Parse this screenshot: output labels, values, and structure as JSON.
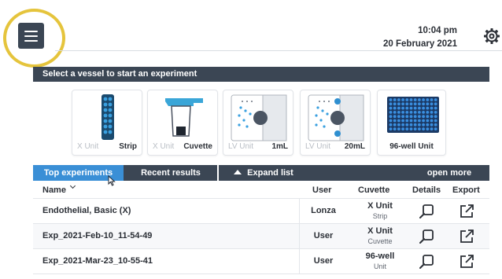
{
  "header": {
    "time": "10:04 pm",
    "date": "20 February 2021"
  },
  "colors": {
    "navy": "#3b4654",
    "accent_blue": "#3a8fd6",
    "highlight_ring": "#e5c43c"
  },
  "section_title": "Select a vessel to start an experiment",
  "vessels": [
    {
      "unit": "X Unit",
      "name": "Strip",
      "icon": "strip-icon"
    },
    {
      "unit": "X Unit",
      "name": "Cuvette",
      "icon": "cuvette-icon"
    },
    {
      "unit": "LV Unit",
      "name": "1mL",
      "icon": "lv-1ml-icon"
    },
    {
      "unit": "LV Unit",
      "name": "20mL",
      "icon": "lv-20ml-icon"
    },
    {
      "unit": "",
      "name": "96-well Unit",
      "icon": "plate-96-well-icon"
    }
  ],
  "tabs": {
    "top_experiments": "Top experiments",
    "recent_results": "Recent results",
    "expand_list": "Expand list",
    "open_more": "open more"
  },
  "table": {
    "columns": {
      "name": "Name",
      "user": "User",
      "cuvette": "Cuvette",
      "details": "Details",
      "export": "Export"
    },
    "rows": [
      {
        "name": "Endothelial, Basic (X)",
        "user": "Lonza",
        "cuvette": "X Unit",
        "cuvette_sub": "Strip"
      },
      {
        "name": "Exp_2021-Feb-10_11-54-49",
        "user": "User",
        "cuvette": "X Unit",
        "cuvette_sub": "Cuvette"
      },
      {
        "name": "Exp_2021-Mar-23_10-55-41",
        "user": "User",
        "cuvette": "96-well",
        "cuvette_sub": "Unit"
      }
    ]
  }
}
